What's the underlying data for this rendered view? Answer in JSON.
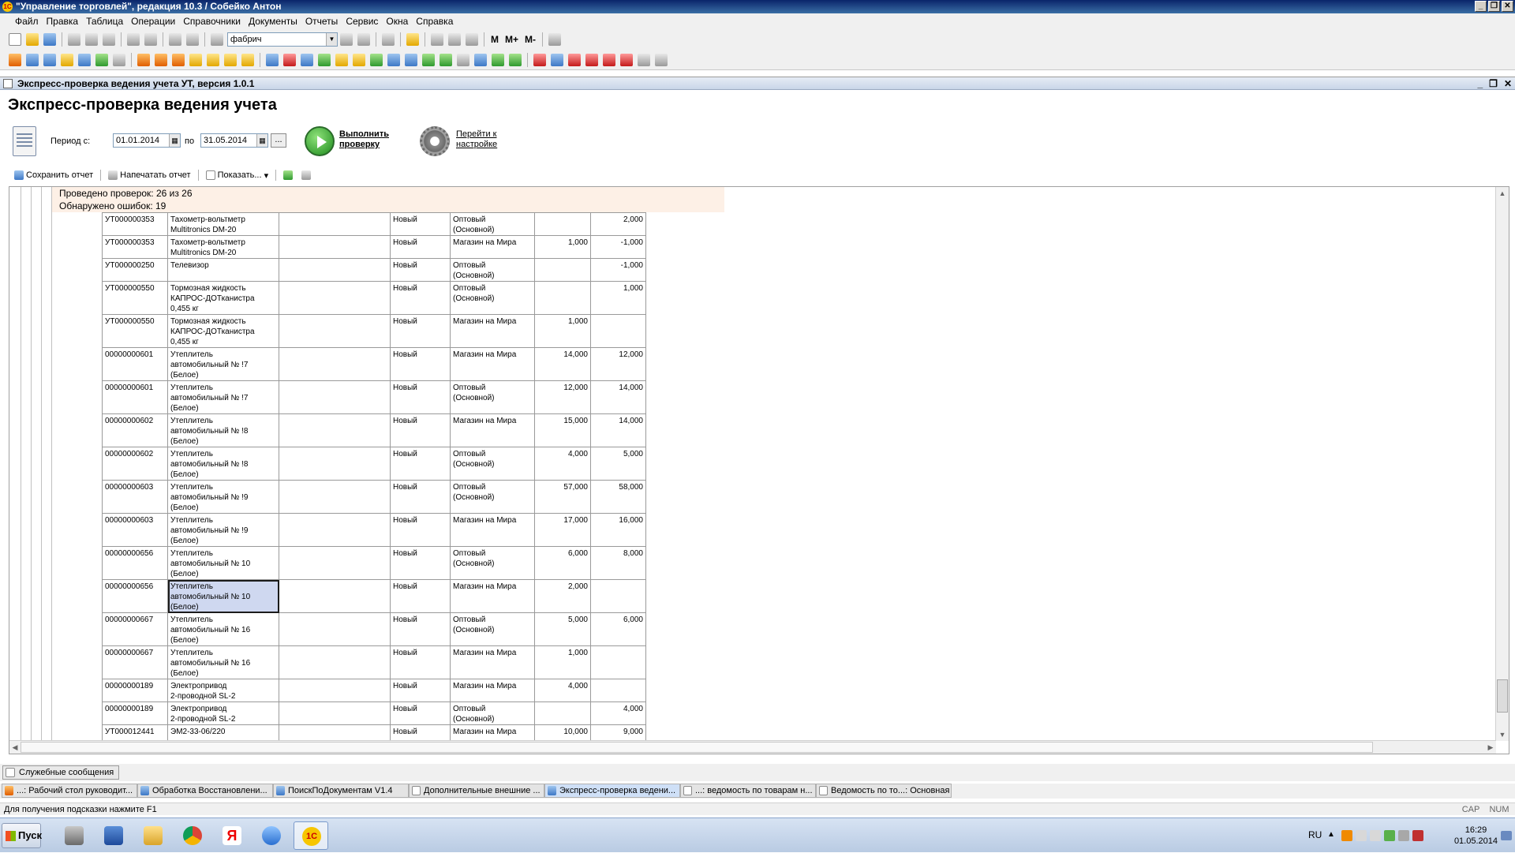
{
  "window": {
    "title": "\"Управление торговлей\", редакция 10.3 / Собейко Антон"
  },
  "menu": [
    "Файл",
    "Правка",
    "Таблица",
    "Операции",
    "Справочники",
    "Документы",
    "Отчеты",
    "Сервис",
    "Окна",
    "Справка"
  ],
  "toolbar": {
    "search_value": "фабрич",
    "m_label": "M",
    "mplus_label": "M+",
    "mminus_label": "M-"
  },
  "doc": {
    "title": "Экспресс-проверка ведения учета УТ, версия 1.0.1",
    "heading": "Экспресс-проверка ведения учета",
    "period_from_label": "Период с:",
    "period_from": "01.01.2014",
    "period_to_label": "по",
    "period_to": "31.05.2014",
    "period_button": "...",
    "run_label": "Выполнить проверку",
    "settings_label": "Перейти к настройке",
    "save_report": "Сохранить отчет",
    "print_report": "Напечатать отчет",
    "show": "Показать...",
    "checks_done": "Проведено проверок: 26 из 26",
    "errors_found": "Обнаружено ошибок: 19"
  },
  "rows": [
    {
      "code": "УТ000000353",
      "name": "Тахометр-вольтметр\nMultitronics DM-20",
      "status": "Новый",
      "warehouse": "Оптовый\n(Основной)",
      "q1": "",
      "q2": "2,000"
    },
    {
      "code": "УТ000000353",
      "name": "Тахометр-вольтметр\nMultitronics DM-20",
      "status": "Новый",
      "warehouse": "Магазин на Мира",
      "q1": "1,000",
      "q2": "-1,000"
    },
    {
      "code": "УТ000000250",
      "name": "Телевизор",
      "status": "Новый",
      "warehouse": "Оптовый\n(Основной)",
      "q1": "",
      "q2": "-1,000"
    },
    {
      "code": "УТ000000550",
      "name": "Тормозная жидкость\nКАПРОС-ДОТканистра\n0,455 кг",
      "status": "Новый",
      "warehouse": "Оптовый\n(Основной)",
      "q1": "",
      "q2": "1,000"
    },
    {
      "code": "УТ000000550",
      "name": "Тормозная жидкость\nКАПРОС-ДОТканистра\n0,455 кг",
      "status": "Новый",
      "warehouse": "Магазин на Мира",
      "q1": "1,000",
      "q2": ""
    },
    {
      "code": "00000000601",
      "name": "Утеплитель\nавтомобильный № !7\n(Белое)",
      "status": "Новый",
      "warehouse": "Магазин на Мира",
      "q1": "14,000",
      "q2": "12,000"
    },
    {
      "code": "00000000601",
      "name": "Утеплитель\nавтомобильный № !7\n(Белое)",
      "status": "Новый",
      "warehouse": "Оптовый\n(Основной)",
      "q1": "12,000",
      "q2": "14,000"
    },
    {
      "code": "00000000602",
      "name": "Утеплитель\nавтомобильный № !8\n(Белое)",
      "status": "Новый",
      "warehouse": "Магазин на Мира",
      "q1": "15,000",
      "q2": "14,000"
    },
    {
      "code": "00000000602",
      "name": "Утеплитель\nавтомобильный № !8\n(Белое)",
      "status": "Новый",
      "warehouse": "Оптовый\n(Основной)",
      "q1": "4,000",
      "q2": "5,000"
    },
    {
      "code": "00000000603",
      "name": "Утеплитель\nавтомобильный № !9\n(Белое)",
      "status": "Новый",
      "warehouse": "Оптовый\n(Основной)",
      "q1": "57,000",
      "q2": "58,000"
    },
    {
      "code": "00000000603",
      "name": "Утеплитель\nавтомобильный № !9\n(Белое)",
      "status": "Новый",
      "warehouse": "Магазин на Мира",
      "q1": "17,000",
      "q2": "16,000"
    },
    {
      "code": "00000000656",
      "name": "Утеплитель\nавтомобильный № 10\n(Белое)",
      "status": "Новый",
      "warehouse": "Оптовый\n(Основной)",
      "q1": "6,000",
      "q2": "8,000"
    },
    {
      "code": "00000000656",
      "name": "Утеплитель\nавтомобильный № 10\n(Белое)",
      "status": "Новый",
      "warehouse": "Магазин на Мира",
      "q1": "2,000",
      "q2": "",
      "selected": true
    },
    {
      "code": "00000000667",
      "name": "Утеплитель\nавтомобильный № 16\n(Белое)",
      "status": "Новый",
      "warehouse": "Оптовый\n(Основной)",
      "q1": "5,000",
      "q2": "6,000"
    },
    {
      "code": "00000000667",
      "name": "Утеплитель\nавтомобильный № 16\n(Белое)",
      "status": "Новый",
      "warehouse": "Магазин на Мира",
      "q1": "1,000",
      "q2": ""
    },
    {
      "code": "00000000189",
      "name": "Электропривод\n2-проводной SL-2",
      "status": "Новый",
      "warehouse": "Магазин на Мира",
      "q1": "4,000",
      "q2": ""
    },
    {
      "code": "00000000189",
      "name": "Электропривод\n2-проводной SL-2",
      "status": "Новый",
      "warehouse": "Оптовый\n(Основной)",
      "q1": "",
      "q2": "4,000"
    },
    {
      "code": "УТ000012441",
      "name": "ЭМ2-33-06/220",
      "status": "Новый",
      "warehouse": "Магазин на Мира",
      "q1": "10,000",
      "q2": "9,000"
    }
  ],
  "service_messages": "Служебные сообщения",
  "window_tabs": [
    "...: Рабочий стол руководит...",
    "Обработка  Восстановлени...",
    "ПоискПоДокументам V1.4",
    "Дополнительные внешние ...",
    "Экспресс-проверка ведени...",
    "...: ведомость по товарам н...",
    "Ведомость по то...: Основная"
  ],
  "status": {
    "hint": "Для получения подсказки нажмите F1",
    "cap": "CAP",
    "num": "NUM"
  },
  "taskbar": {
    "start": "Пуск",
    "lang": "RU",
    "time": "16:29",
    "date": "01.05.2014"
  }
}
